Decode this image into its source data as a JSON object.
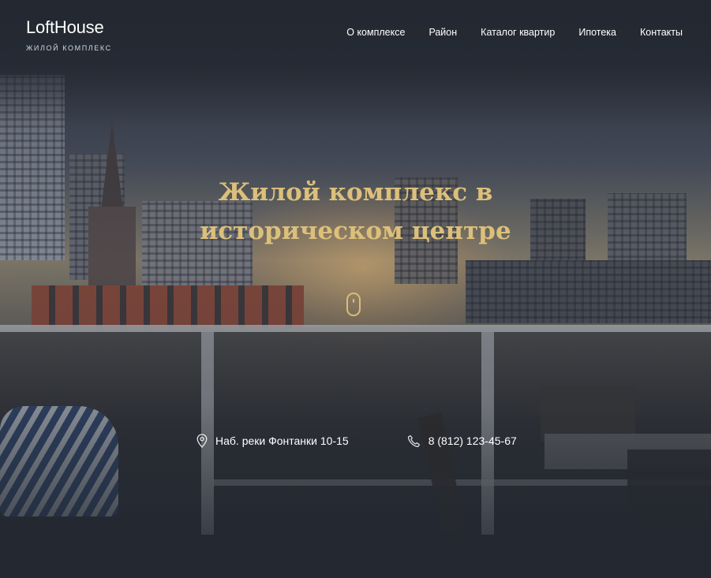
{
  "brand": {
    "name": "LoftHouse",
    "tagline": "жилой комплекс"
  },
  "nav": {
    "items": [
      {
        "label": "О комплексе"
      },
      {
        "label": "Район"
      },
      {
        "label": "Каталог квартир"
      },
      {
        "label": "Ипотека"
      },
      {
        "label": "Контакты"
      }
    ]
  },
  "hero": {
    "title_line1": "Жилой комплекс в",
    "title_line2": "историческом центре",
    "scroll_icon": "mouse-scroll-icon"
  },
  "contacts": {
    "address": "Наб. реки Фонтанки 10-15",
    "address_icon": "map-pin-icon",
    "phone": "8 (812) 123-45-67",
    "phone_icon": "phone-icon"
  },
  "colors": {
    "accent_gold": "#dcc07a",
    "header_bg": "#232831",
    "text": "#ffffff"
  }
}
